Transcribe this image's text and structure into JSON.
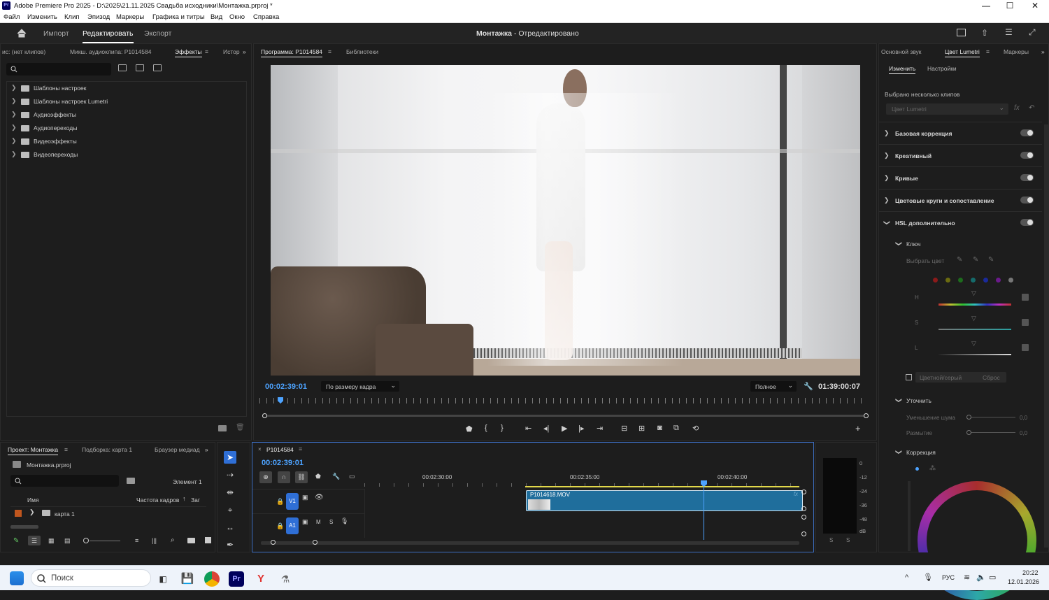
{
  "window": {
    "title": "Adobe Premiere Pro 2025 - D:\\2025\\21.11.2025 Свадьба исходники\\Монтажка.prproj *",
    "app_icon": "Pr",
    "controls": {
      "minimize": "—",
      "maximize": "☐",
      "close": "✕"
    }
  },
  "menu": [
    "Файл",
    "Изменить",
    "Клип",
    "Эпизод",
    "Маркеры",
    "Графика и титры",
    "Вид",
    "Окно",
    "Справка"
  ],
  "header": {
    "home_icon": "home-icon",
    "import": "Импорт",
    "edit": "Редактировать",
    "export": "Экспорт",
    "project_title": "Монтажка",
    "project_state": " - Отредактировано"
  },
  "effects_panel": {
    "tabs": [
      "ис: (нет клипов)",
      "Микш. аудиоклипа: P1014584",
      "Эффекты",
      "Истор"
    ],
    "active_tab": "Эффекты",
    "items": [
      "Шаблоны настроек",
      "Шаблоны настроек Lumetri",
      "Аудиоэффекты",
      "Аудиопереходы",
      "Видеоэффекты",
      "Видеопереходы"
    ]
  },
  "program_monitor": {
    "tabs": [
      "Программа: P1014584",
      "Библиотеки"
    ],
    "timecode": "00:02:39:01",
    "fit": "По размеру кадра",
    "quality": "Полное",
    "duration": "01:39:00:07",
    "playhead_fraction": 0.03
  },
  "lumetri": {
    "tabs": [
      "Основной звук",
      "Цвет Lumetri",
      "Маркеры"
    ],
    "subtabs": [
      "Изменить",
      "Настройки"
    ],
    "selection_note": "Выбрано несколько клипов",
    "preset": "Цвет Lumetri",
    "sections": [
      "Базовая коррекция",
      "Креативный",
      "Кривые",
      "Цветовые круги и сопоставление",
      "HSL дополнительно"
    ],
    "key_label": "Ключ",
    "pick_color": "Выбрать цвет",
    "hsl": [
      "H",
      "S",
      "L"
    ],
    "color_gray": "Цветной/серый",
    "reset": "Сброс",
    "refine": "Уточнить",
    "denoise": "Уменьшение шума",
    "blur": "Размытие",
    "denoise_value": "0,0",
    "blur_value": "0,0",
    "correction": "Коррекция",
    "swatch_colors": [
      "#8b1a1a",
      "#6b6b10",
      "#1d6b1d",
      "#156b6b",
      "#1a2a9b",
      "#6b1a8b",
      "#777777"
    ]
  },
  "project_panel": {
    "tabs": [
      "Проект: Монтажка",
      "Подборка: карта 1",
      "Браузер медиад"
    ],
    "file": "Монтажка.prproj",
    "count": "Элемент 1",
    "cols": {
      "name": "Имя",
      "fps": "Частота кадров",
      "sort": "↑",
      "more": "Заг"
    },
    "row": "карта 1"
  },
  "timeline": {
    "tab": "P1014584",
    "timecode": "00:02:39:01",
    "ruler": [
      "00:02:30:00",
      "00:02:35:00",
      "00:02:40:00"
    ],
    "tracks": [
      {
        "name": "V1"
      },
      {
        "name": "A1",
        "m": "M",
        "s": "S"
      }
    ],
    "clip": "P1014618.MOV",
    "clip_fx": "fx"
  },
  "meter": {
    "labels": [
      "0",
      "-12",
      "-24",
      "-36",
      "-48",
      "dB"
    ],
    "solo": [
      "S",
      "S"
    ]
  },
  "taskbar": {
    "search": "Поиск",
    "lang": "РУС",
    "time": "20:22",
    "date": "12.01.2026"
  }
}
